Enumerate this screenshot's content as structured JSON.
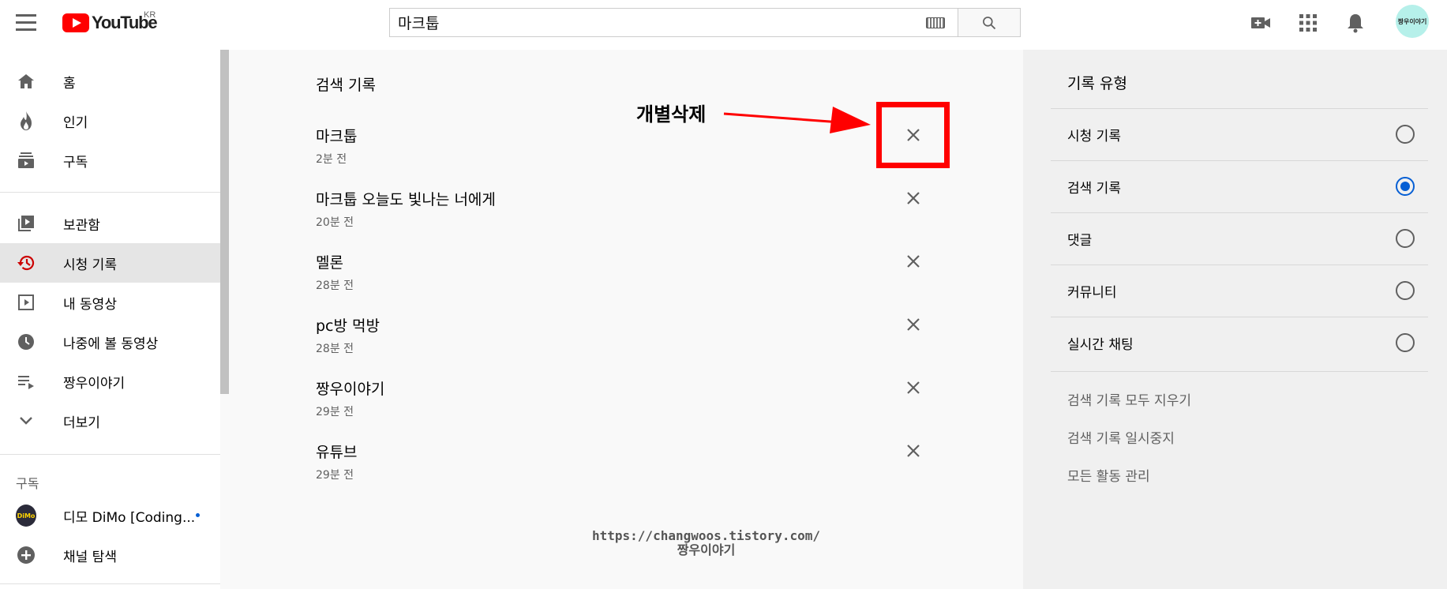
{
  "header": {
    "logo_text": "YouTube",
    "logo_region": "KR",
    "search_value": "마크툽",
    "avatar_text": "짱우이야기",
    "icons": [
      "menu-icon",
      "keyboard-icon",
      "search-icon",
      "create-video-icon",
      "apps-icon",
      "notifications-icon"
    ]
  },
  "sidebar": {
    "items": [
      {
        "label": "홈",
        "icon": "home-icon"
      },
      {
        "label": "인기",
        "icon": "trending-icon"
      },
      {
        "label": "구독",
        "icon": "subscriptions-icon"
      },
      {
        "label": "보관함",
        "icon": "library-icon"
      },
      {
        "label": "시청 기록",
        "icon": "history-icon",
        "active": true
      },
      {
        "label": "내 동영상",
        "icon": "my-videos-icon"
      },
      {
        "label": "나중에 볼 동영상",
        "icon": "watch-later-icon"
      },
      {
        "label": "짱우이야기",
        "icon": "playlist-icon"
      },
      {
        "label": "더보기",
        "icon": "chevron-down-icon"
      }
    ],
    "section_title": "구독",
    "subscription": {
      "label": "디모 DiMo [Coding...",
      "avatar_text": "DiMo"
    },
    "browse_channels": "채널 탐색"
  },
  "main": {
    "title": "검색 기록",
    "history": [
      {
        "title": "마크툽",
        "time": "2분 전"
      },
      {
        "title": "마크툽 오늘도 빛나는 너에게",
        "time": "20분 전"
      },
      {
        "title": "멜론",
        "time": "28분 전"
      },
      {
        "title": "pc방 먹방",
        "time": "28분 전"
      },
      {
        "title": "짱우이야기",
        "time": "29분 전"
      },
      {
        "title": "유튜브",
        "time": "29분 전"
      }
    ],
    "annotation": "개별삭제",
    "annotation_color": "#ff0000",
    "watermark_line1": "https://changwoos.tistory.com/",
    "watermark_line2": "짱우이야기"
  },
  "right_panel": {
    "title": "기록 유형",
    "options": [
      {
        "label": "시청 기록",
        "checked": false
      },
      {
        "label": "검색 기록",
        "checked": true
      },
      {
        "label": "댓글",
        "checked": false
      },
      {
        "label": "커뮤니티",
        "checked": false
      },
      {
        "label": "실시간 채팅",
        "checked": false
      }
    ],
    "links": [
      "검색 기록 모두 지우기",
      "검색 기록 일시중지",
      "모든 활동 관리"
    ],
    "accent_color": "#065fd4"
  }
}
